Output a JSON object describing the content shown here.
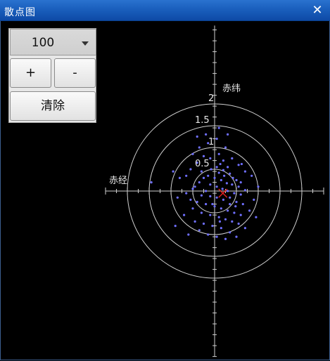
{
  "window": {
    "title": "散点图",
    "close_symbol": "✕"
  },
  "controls": {
    "count_value": "100",
    "plus_label": "+",
    "minus_label": "-",
    "clear_label": "清除"
  },
  "plot": {
    "vertical_axis_label": "赤纬",
    "horizontal_axis_label": "赤经",
    "ring_labels": [
      "0.5",
      "1",
      "1.5",
      "2"
    ],
    "colors": {
      "background": "#000000",
      "grid": "#cfcfcf",
      "points": "#6f6fff",
      "center_marker": "#e02020"
    }
  },
  "chart_data": {
    "type": "scatter",
    "ring_radii": [
      0.5,
      1,
      1.5,
      2
    ],
    "xlim": [
      -2.5,
      2.5
    ],
    "ylim": [
      -3.8,
      3.8
    ],
    "center_marker": [
      0.19,
      -0.05
    ],
    "points": [
      [
        0.05,
        0.55
      ],
      [
        0.13,
        0.62
      ],
      [
        0.2,
        0.48
      ],
      [
        0.3,
        0.55
      ],
      [
        -0.08,
        0.5
      ],
      [
        0.1,
        0.42
      ],
      [
        0.22,
        0.35
      ],
      [
        0.35,
        0.4
      ],
      [
        0.42,
        0.3
      ],
      [
        0.5,
        0.25
      ],
      [
        -0.15,
        0.35
      ],
      [
        -0.25,
        0.3
      ],
      [
        0.0,
        0.3
      ],
      [
        0.15,
        0.25
      ],
      [
        0.28,
        0.18
      ],
      [
        0.4,
        0.15
      ],
      [
        0.55,
        0.1
      ],
      [
        0.6,
        0.2
      ],
      [
        -0.35,
        0.2
      ],
      [
        -0.45,
        0.1
      ],
      [
        -0.1,
        0.15
      ],
      [
        0.05,
        0.1
      ],
      [
        0.18,
        0.05
      ],
      [
        0.3,
        0.0
      ],
      [
        0.45,
        -0.05
      ],
      [
        0.6,
        -0.08
      ],
      [
        0.7,
        0.02
      ],
      [
        -0.2,
        0.0
      ],
      [
        -0.5,
        0.05
      ],
      [
        -0.65,
        -0.05
      ],
      [
        -0.3,
        -0.1
      ],
      [
        -0.1,
        -0.12
      ],
      [
        0.05,
        -0.15
      ],
      [
        0.2,
        -0.2
      ],
      [
        0.35,
        -0.15
      ],
      [
        0.5,
        -0.25
      ],
      [
        0.65,
        -0.3
      ],
      [
        -0.4,
        -0.25
      ],
      [
        -0.2,
        -0.3
      ],
      [
        0.0,
        -0.35
      ],
      [
        0.15,
        -0.4
      ],
      [
        0.3,
        -0.45
      ],
      [
        0.45,
        -0.5
      ],
      [
        -0.5,
        -0.4
      ],
      [
        -0.3,
        -0.5
      ],
      [
        -0.1,
        -0.55
      ],
      [
        0.1,
        -0.6
      ],
      [
        0.25,
        -0.65
      ],
      [
        0.4,
        -0.7
      ],
      [
        0.55,
        -0.75
      ],
      [
        -0.45,
        -0.7
      ],
      [
        -0.25,
        -0.75
      ],
      [
        -0.05,
        -0.8
      ],
      [
        0.15,
        -0.85
      ],
      [
        0.35,
        -0.95
      ],
      [
        -0.15,
        -1.0
      ],
      [
        0.05,
        -1.05
      ],
      [
        0.25,
        -1.1
      ],
      [
        -0.35,
        -0.9
      ],
      [
        0.6,
        -0.55
      ],
      [
        -0.1,
        0.75
      ],
      [
        0.1,
        0.85
      ],
      [
        -0.25,
        0.8
      ],
      [
        -0.4,
        0.65
      ],
      [
        -0.55,
        0.5
      ],
      [
        -0.65,
        0.35
      ],
      [
        0.4,
        0.75
      ],
      [
        0.55,
        0.6
      ],
      [
        0.7,
        0.45
      ],
      [
        0.25,
        1.0
      ],
      [
        -0.35,
        1.0
      ],
      [
        -0.15,
        1.1
      ],
      [
        0.05,
        1.2
      ],
      [
        -0.5,
        0.85
      ],
      [
        0.85,
        0.35
      ],
      [
        0.9,
        -0.2
      ],
      [
        0.8,
        -0.45
      ],
      [
        -0.8,
        0.3
      ],
      [
        -0.85,
        -0.15
      ],
      [
        -0.7,
        -0.55
      ],
      [
        -0.6,
        -1.0
      ],
      [
        0.7,
        -0.85
      ],
      [
        0.5,
        -1.05
      ],
      [
        -0.2,
        1.3
      ],
      [
        0.3,
        1.3
      ],
      [
        0.1,
        1.45
      ],
      [
        -0.4,
        1.25
      ],
      [
        1.0,
        0.1
      ],
      [
        -0.95,
        0.45
      ],
      [
        0.95,
        -0.6
      ],
      [
        -0.9,
        -0.8
      ],
      [
        0.2,
        0.7
      ],
      [
        -0.05,
        -0.3
      ],
      [
        0.35,
        -0.3
      ],
      [
        -0.3,
        0.45
      ],
      [
        0.48,
        -0.35
      ],
      [
        0.12,
        -0.7
      ],
      [
        -0.55,
        -0.2
      ],
      [
        0.62,
        0.62
      ],
      [
        -1.45,
        0.2
      ]
    ]
  }
}
